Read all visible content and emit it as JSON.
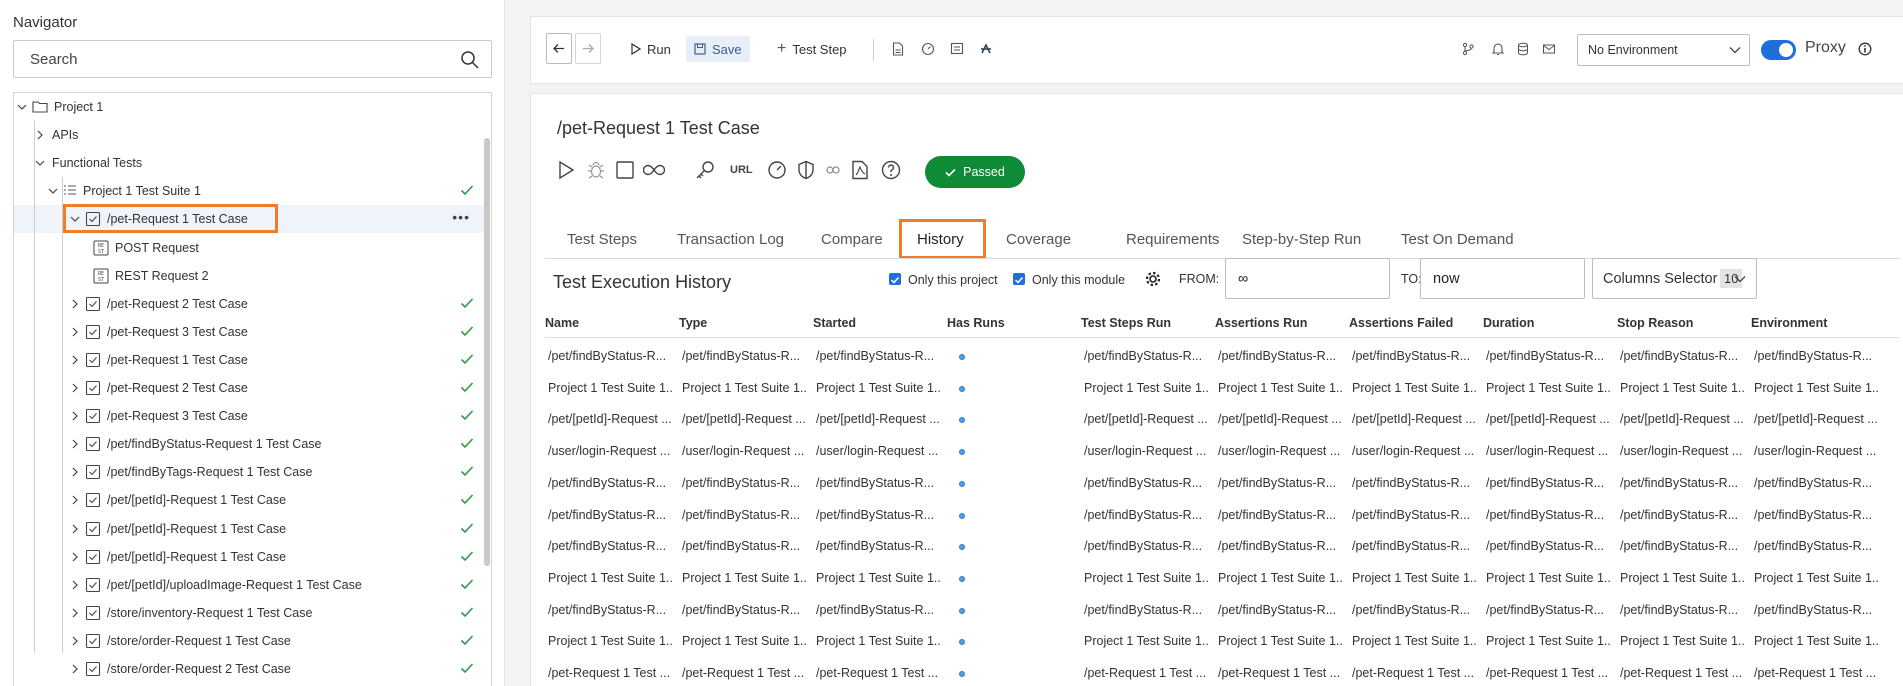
{
  "navigator": {
    "title": "Navigator",
    "search_placeholder": "Search",
    "tree": [
      {
        "label": "Project 1",
        "level": 0,
        "kind": "folder",
        "expanded": true
      },
      {
        "label": "APIs",
        "level": 1,
        "kind": "none",
        "expanded": false
      },
      {
        "label": "Functional Tests",
        "level": 1,
        "kind": "none",
        "expanded": true
      },
      {
        "label": "Project 1 Test Suite 1",
        "level": 2,
        "kind": "suite",
        "expanded": true,
        "passed": true
      },
      {
        "label": "/pet-Request 1 Test Case",
        "level": 3,
        "kind": "case",
        "expanded": true,
        "selected": true
      },
      {
        "label": "POST Request",
        "level": 4,
        "kind": "request"
      },
      {
        "label": "REST Request 2",
        "level": 4,
        "kind": "request"
      },
      {
        "label": "/pet-Request 2 Test Case",
        "level": 3,
        "kind": "case",
        "passed": true
      },
      {
        "label": "/pet-Request 3 Test Case",
        "level": 3,
        "kind": "case",
        "passed": true
      },
      {
        "label": "/pet-Request 1 Test Case",
        "level": 3,
        "kind": "case",
        "passed": true
      },
      {
        "label": "/pet-Request 2 Test Case",
        "level": 3,
        "kind": "case",
        "passed": true
      },
      {
        "label": "/pet-Request 3 Test Case",
        "level": 3,
        "kind": "case",
        "passed": true
      },
      {
        "label": "/pet/findByStatus-Request 1 Test Case",
        "level": 3,
        "kind": "case",
        "passed": true
      },
      {
        "label": "/pet/findByTags-Request 1 Test Case",
        "level": 3,
        "kind": "case",
        "passed": true
      },
      {
        "label": "/pet/[petId]-Request 1 Test Case",
        "level": 3,
        "kind": "case",
        "passed": true
      },
      {
        "label": "/pet/[petId]-Request 1 Test Case",
        "level": 3,
        "kind": "case",
        "passed": true
      },
      {
        "label": "/pet/[petId]-Request 1 Test Case",
        "level": 3,
        "kind": "case",
        "passed": true
      },
      {
        "label": "/pet/[petId]/uploadImage-Request 1 Test Case",
        "level": 3,
        "kind": "case",
        "passed": true
      },
      {
        "label": "/store/inventory-Request 1 Test Case",
        "level": 3,
        "kind": "case",
        "passed": true
      },
      {
        "label": "/store/order-Request 1 Test Case",
        "level": 3,
        "kind": "case",
        "passed": true
      },
      {
        "label": "/store/order-Request 2 Test Case",
        "level": 3,
        "kind": "case",
        "passed": true
      }
    ]
  },
  "toolbar": {
    "run_label": "Run",
    "save_label": "Save",
    "test_step_label": "Test Step",
    "environment": "No Environment",
    "proxy_label": "Proxy",
    "proxy_on": true
  },
  "main": {
    "title": "/pet-Request 1 Test Case",
    "url_label": "URL",
    "status": "Passed",
    "tabs": [
      "Test Steps",
      "Transaction Log",
      "Compare",
      "History",
      "Coverage",
      "Requirements",
      "Step-by-Step Run",
      "Test On Demand"
    ],
    "active_tab": "History"
  },
  "history": {
    "title": "Test Execution History",
    "only_project_label": "Only this project",
    "only_module_label": "Only this module",
    "from_label": "FROM:",
    "from_value": "∞",
    "to_label": "TO:",
    "to_value": "now",
    "columns_selector_label": "Columns Selector",
    "columns_count": "10",
    "columns": [
      "Name",
      "Type",
      "Started",
      "Has Runs",
      "Test Steps Run",
      "Assertions Run",
      "Assertions Failed",
      "Duration",
      "Stop Reason",
      "Environment"
    ],
    "rows": [
      "/pet/findByStatus-R...",
      "Project 1 Test Suite 1...",
      "/pet/[petId]-Request ...",
      "/user/login-Request ...",
      "/pet/findByStatus-R...",
      "/pet/findByStatus-R...",
      "/pet/findByStatus-R...",
      "Project 1 Test Suite 1...",
      "/pet/findByStatus-R...",
      "Project 1 Test Suite 1...",
      "/pet-Request 1 Test ..."
    ]
  },
  "colors": {
    "accent": "#1e6fd9",
    "highlight": "#f07c27",
    "passed": "#0f8a36",
    "check": "#2e9a4a"
  }
}
